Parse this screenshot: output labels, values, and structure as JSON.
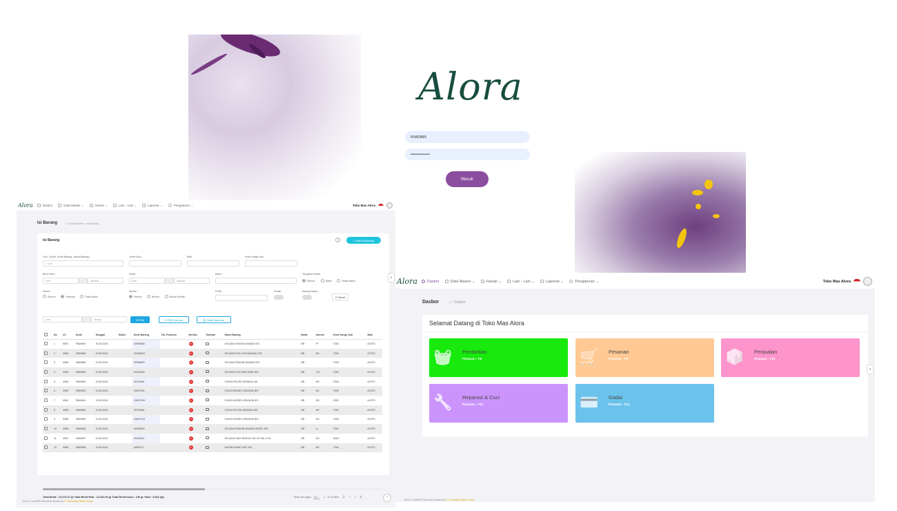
{
  "login": {
    "logo": "Alora",
    "username": "NVADMIN",
    "password": "••••••••••••••••",
    "submit_label": "Masuk"
  },
  "nav": {
    "brand": "Alora",
    "items": [
      "Dasbor",
      "Data Master",
      "Harian",
      "Lain - Lain",
      "Laporan",
      "Pengaturan"
    ],
    "store": "Toko Mas Alora"
  },
  "isi": {
    "page_title": "Isi Barang",
    "breadcrumb": "› Data Master › Isi Barang",
    "card_title": "Isi Barang",
    "add_button": "+ Buat Isi Barang",
    "filters": {
      "search_label": "Cari : (Kode, Kode Barang, Nama Barang)",
      "search_placeholder": "Cari",
      "jenis_label": "Jenis Grup :",
      "baki_label": "Baki :",
      "kode_harga_label": "Kode Harga Jual :",
      "berat_label": "Berat Real :",
      "berat_from": "Dari",
      "berat_to": "Sampai",
      "kadar_label": "Kadar :",
      "kadar_from": "Dari",
      "kadar_to": "Sampai",
      "batch_label": "Batch :",
      "tampilkan_label": "Tampilkan Batch",
      "tampilkan_opts": [
        "Semua",
        "Batch",
        "Tanpa Batch"
      ],
      "status_label": "Status :",
      "status_opts": [
        "Semua",
        "Tersedia",
        "Tidak Halen"
      ],
      "berlian_label": "Berlian :",
      "berlian_opts": [
        "Semua",
        "Berlian",
        "Bukan Berlian"
      ],
      "prefix_label": "Prefix :",
      "rusak_label": "Rusak",
      "barang_hapus_label": "Barang Hapus",
      "reset_label": "✕ Reset",
      "date_from": "Dari",
      "date_to": "Tempo",
      "pilih_label": "☑ Pilih",
      "pilih_semua_label": "☑ Pilih Semua",
      "cetak_label": "⎙ Cetak Barcode"
    },
    "columns": [
      "",
      "No",
      "ID ↓",
      "Kode",
      "Tanggal",
      "Batch",
      "Kode Barang",
      "No. Pesanan",
      "Berlian",
      "Gambar",
      "Nama Barang",
      "Kadar",
      "Ukuran",
      "Kode Harga Jual",
      "Baki"
    ],
    "rows": [
      [
        "1",
        "6967",
        "PA69967",
        "15.05.2024",
        "",
        "GRN5565",
        "",
        "GELANG RANTAI MANASI IES",
        "3IR",
        "FT",
        "T300",
        "#1STD"
      ],
      [
        "2",
        "6966",
        "PA69966",
        "15.05.2024",
        "",
        "GHN8KAJ",
        "",
        "GELANG HOLLOW MANUAL IES",
        "3IR",
        "KH",
        "T300",
        "#1STD"
      ],
      [
        "3",
        "6965",
        "PA69965",
        "15.05.2024",
        "",
        "GRN5603",
        "",
        "GELANG RANTAI MANASI IES",
        "3IR",
        "",
        "T300",
        "#1STD"
      ],
      [
        "4",
        "6964",
        "PA69964",
        "15.05.2024",
        "",
        "GGA3046",
        "",
        "GELANG GOLONG ANAK IES",
        "3IR",
        "LS7",
        "T300",
        "#1STD"
      ],
      [
        "5",
        "6963",
        "PA69963",
        "15.05.2024",
        "",
        "CPD3469",
        "",
        "CINCIN PELEK DEWASA GB",
        "3IR",
        "HR",
        "F300",
        "#1STD"
      ],
      [
        "6",
        "6962",
        "PA69962",
        "15.05.2024",
        "",
        "CMD3Y0L",
        "",
        "CINCIN MODEL DEWASA IES",
        "3IR",
        "HA",
        "F300",
        "#1STD"
      ],
      [
        "7",
        "6961",
        "PA69961",
        "15.05.2024",
        "",
        "CMD3Y0K",
        "",
        "CINCIN MODEL DEWASA IES",
        "3IR",
        "GD",
        "K300",
        "#1STD"
      ],
      [
        "8",
        "6960",
        "PA69960",
        "15.05.2024",
        "",
        "CPD3468",
        "",
        "CINCIN PELEK DEWASA IES",
        "3IR",
        "HR",
        "T300",
        "#1STD"
      ],
      [
        "9",
        "6959",
        "PA69959",
        "15.05.2024",
        "",
        "CMD3Y0J",
        "",
        "CINCIN MODEL DEWASA IES",
        "3IR",
        "HA",
        "T300",
        "#1STD"
      ],
      [
        "10",
        "6958",
        "PA69958",
        "15.05.2024",
        "",
        "GRN560C",
        "",
        "GELANG RANTAI MANASI AKREL IES",
        "3IR",
        "LL",
        "T300",
        "#1STD"
      ],
      [
        "11",
        "6957",
        "PA69957",
        "15.05.2024",
        "",
        "GKN002J",
        "",
        "GELANG KAKI RANTAI 1SH IK ITALY IOL",
        "3IR",
        "KH",
        "D300",
        "#1STD"
      ],
      [
        "12",
        "6956",
        "PA69956",
        "15.05.2024",
        "",
        "AAR3C9",
        "",
        "ANTING ANAK KAIT IES",
        "3IR",
        "HR",
        "T300",
        "#1STD"
      ]
    ],
    "totals": "Total Berat : 12,474.07 gr   Total Berat Real : 12,422.40 gr   Total Berat Kotor : 240 gr   Total : 3,644 Qty",
    "rows_per_page_label": "Items per page :",
    "rows_per_page": "10",
    "range": "1 - 12 of 3644",
    "footer_prefix": "2024 © GoldGRP Merchant System by",
    "footer_org": "PT Nusantara Mitra Global"
  },
  "dash": {
    "page_title": "Dasbor",
    "breadcrumb": "› Dasbor",
    "welcome": "Selamat Datang di Toko Mas Alora",
    "tiles": [
      {
        "name": "Pembelian",
        "key": "Pintasan : F8",
        "color": "#17ea0c",
        "icon": "basket-icon",
        "glyph": "🧺"
      },
      {
        "name": "Pesanan",
        "key": "Pintasan : F9",
        "color": "#fec994",
        "icon": "cart-icon",
        "glyph": "🛒"
      },
      {
        "name": "Penjualan",
        "key": "Pintasan : F10",
        "color": "#fd94cb",
        "icon": "boxes-icon",
        "glyph": "📦"
      },
      {
        "name": "Reparasi & Cuci",
        "key": "Pintasan : F11",
        "color": "#cb94fc",
        "icon": "wrench-icon",
        "glyph": "🔧"
      },
      {
        "name": "Gadai",
        "key": "Pintasan : F12",
        "color": "#6bc3ec",
        "icon": "card-icon",
        "glyph": "💳"
      }
    ],
    "footer_prefix": "2024 © GoldGRP Merchant System by",
    "footer_org": "PT Nusantara Mitra Global"
  }
}
